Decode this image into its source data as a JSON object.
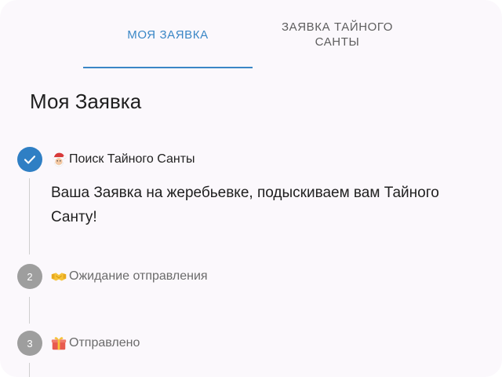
{
  "tabs": [
    {
      "label": "Моя заявка",
      "active": true
    },
    {
      "label": "Заявка Тайного Санты",
      "active": false
    }
  ],
  "page": {
    "title": "Моя Заявка"
  },
  "steps": [
    {
      "number": "1",
      "icon": "santa-emoji",
      "label": "Поиск Тайного Санты",
      "state": "completed",
      "body": "Ваша Заявка на жеребьевке, подыскиваем вам Тайного Санту!"
    },
    {
      "number": "2",
      "icon": "handshake-emoji",
      "label": "Ожидание отправления",
      "state": "pending"
    },
    {
      "number": "3",
      "icon": "gift-emoji",
      "label": "Отправлено",
      "state": "pending"
    }
  ],
  "colors": {
    "accent": "#3a87c6",
    "step_active": "#2f7fc4",
    "step_pending": "#9e9e9e",
    "background": "#fbf8fc"
  }
}
